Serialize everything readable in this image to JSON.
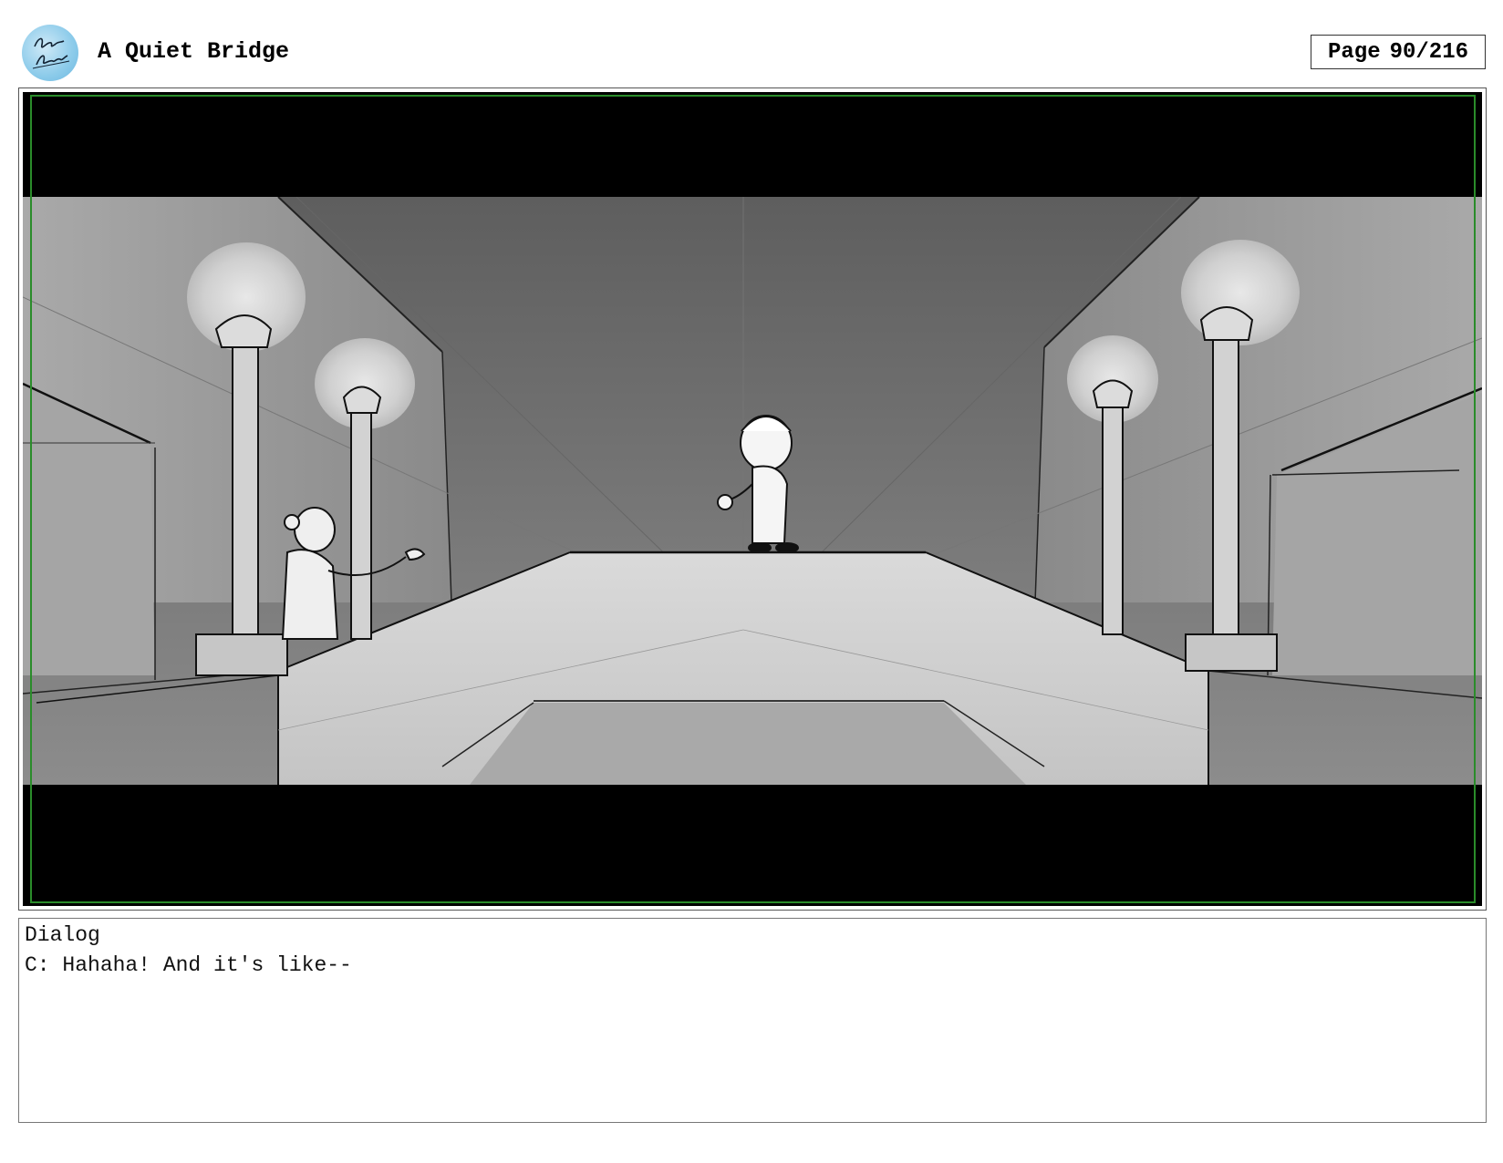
{
  "header": {
    "title": "A Quiet Bridge",
    "page_label": "Page",
    "page_number": "90/216",
    "logo_text": "Anna Brown"
  },
  "panel": {
    "description_icon": "storyboard-panel"
  },
  "dialog": {
    "label": "Dialog",
    "line": "C: Hahaha! And it's like--"
  },
  "colors": {
    "safe_guide": "#2a8c2a",
    "letterbox": "#000000"
  }
}
